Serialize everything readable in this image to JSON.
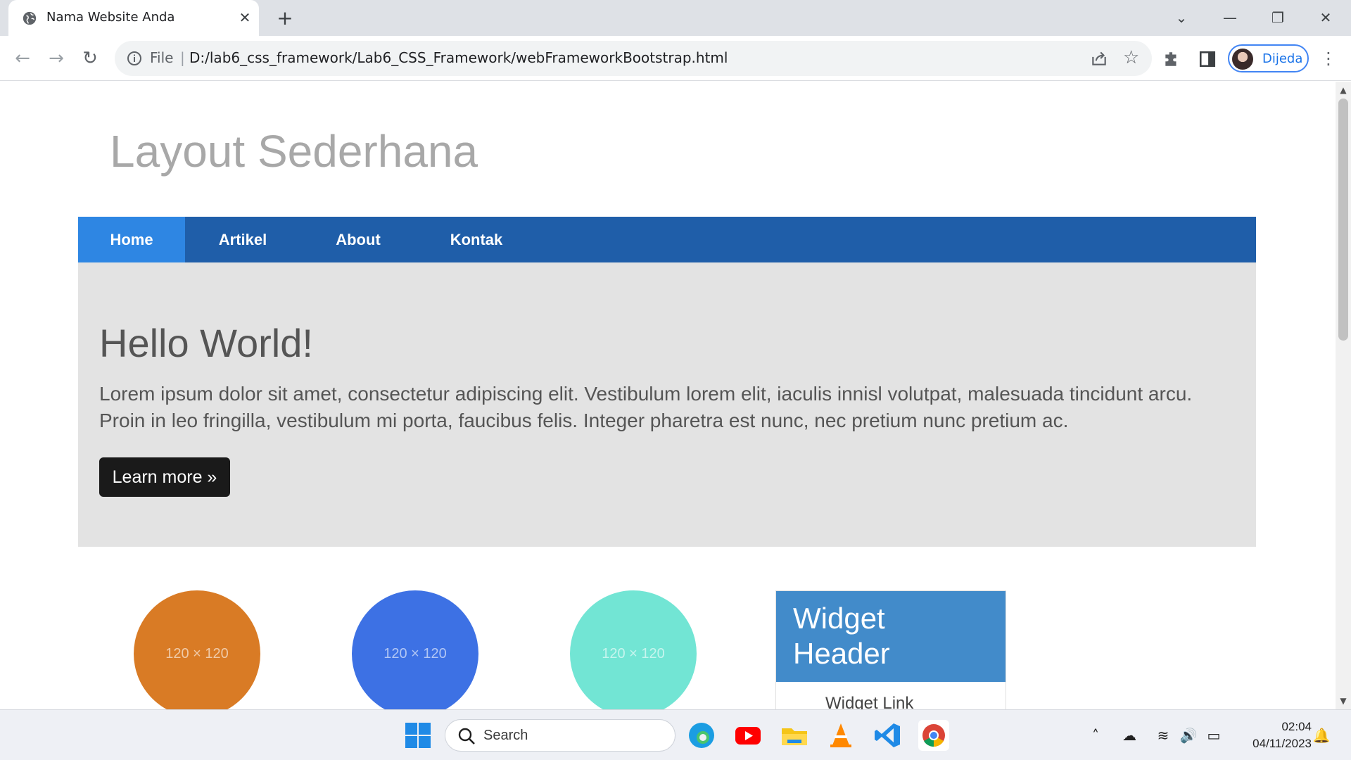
{
  "browser": {
    "tab_title": "Nama Website Anda",
    "scheme_label": "File",
    "url": "D:/lab6_css_framework/Lab6_CSS_Framework/webFrameworkBootstrap.html",
    "profile_name": "Dijeda"
  },
  "page": {
    "site_title": "Layout Sederhana",
    "nav": [
      "Home",
      "Artikel",
      "About",
      "Kontak"
    ],
    "active_nav": "Home",
    "hero": {
      "heading": "Hello World!",
      "body": "Lorem ipsum dolor sit amet, consectetur adipiscing elit. Vestibulum lorem elit, iaculis innisl volutpat, malesuada tincidunt arcu. Proin in leo fringilla, vestibulum mi porta, faucibus felis. Integer pharetra est nunc, nec pretium nunc pretium ac.",
      "button": "Learn more »"
    },
    "thumbnails": [
      {
        "label": "120 × 120",
        "color": "#d97b25"
      },
      {
        "label": "120 × 120",
        "color": "#3d71e4"
      },
      {
        "label": "120 × 120",
        "color": "#72e5d4"
      }
    ],
    "widget": {
      "header": "Widget Header",
      "link": "Widget Link"
    }
  },
  "taskbar": {
    "search_placeholder": "Search",
    "time": "02:04",
    "date": "04/11/2023"
  },
  "colors": {
    "navbar": "#1f5ea9",
    "nav_active": "#2e86e3",
    "hero_bg": "#e3e3e3",
    "widget_header": "#428bca"
  }
}
